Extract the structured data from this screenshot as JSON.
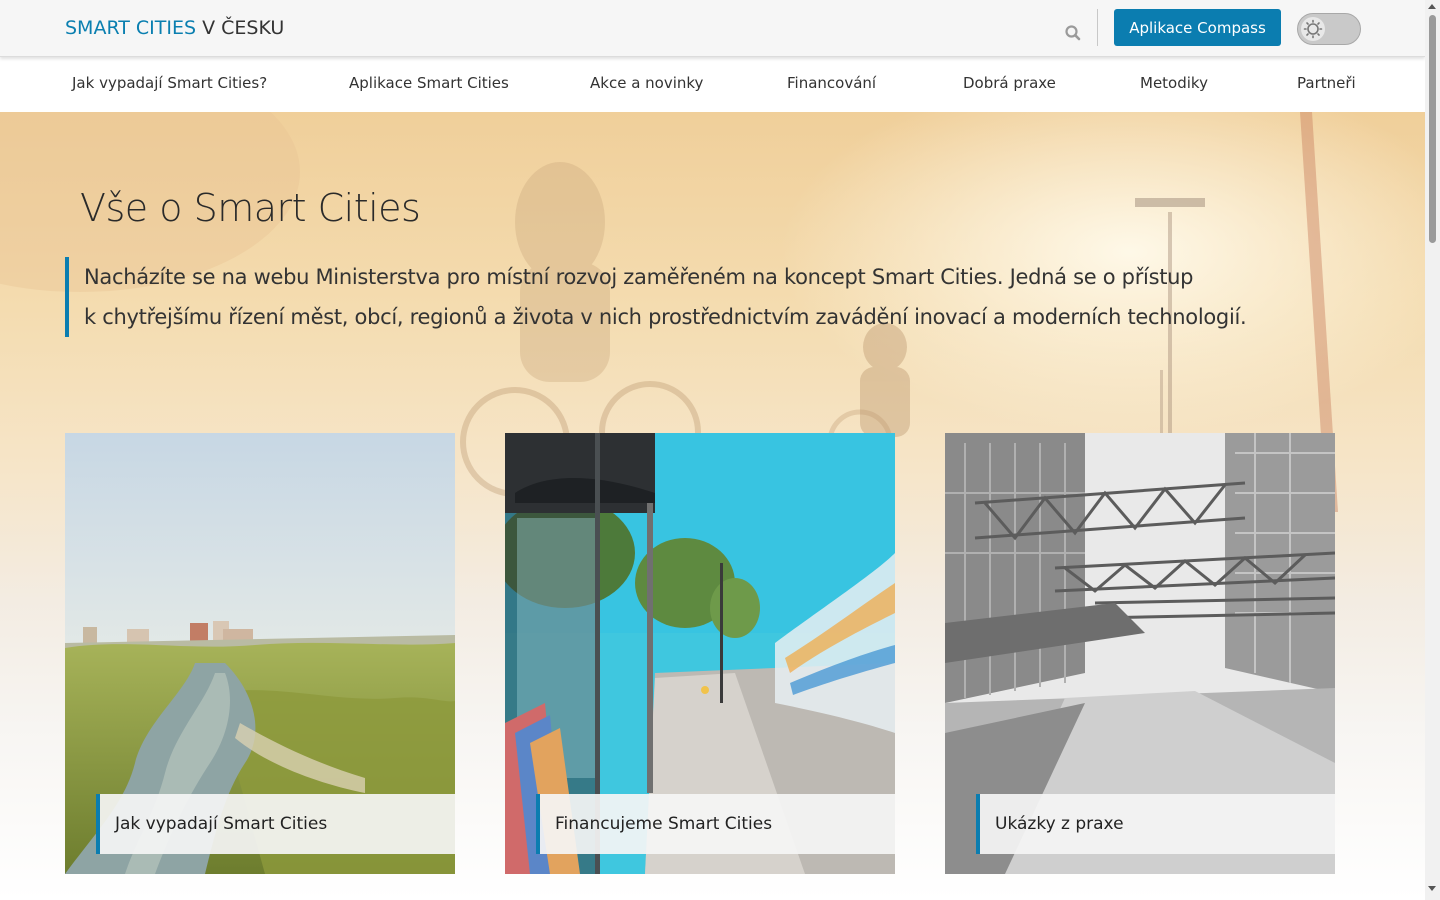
{
  "header": {
    "logo_accent": "SMART CITIES",
    "logo_rest": "V ČESKU",
    "search_icon": "search-icon",
    "compass_label": "Aplikace Compass",
    "theme_icon": "sun-icon"
  },
  "nav": {
    "items": [
      {
        "label": "Jak vypadají Smart Cities?"
      },
      {
        "label": "Aplikace Smart Cities"
      },
      {
        "label": "Akce a novinky"
      },
      {
        "label": "Financování"
      },
      {
        "label": "Dobrá praxe"
      },
      {
        "label": "Metodiky"
      },
      {
        "label": "Partneři"
      }
    ]
  },
  "hero": {
    "title": "Vše o Smart Cities",
    "lead_line1": "Nacházíte se na webu Ministerstva pro místní rozvoj zaměřeném na koncept Smart Cities. Jedná se o přístup",
    "lead_line2": "k chytřejšímu řízení měst, obcí, regionů a života v nich prostřednictvím zavádění inovací a moderních technologií."
  },
  "cards": [
    {
      "label": "Jak vypadají Smart Cities"
    },
    {
      "label": "Financujeme Smart Cities"
    },
    {
      "label": "Ukázky z praxe"
    }
  ],
  "colors": {
    "accent": "#0b7db0",
    "logo_accent": "#0a7fb0"
  }
}
